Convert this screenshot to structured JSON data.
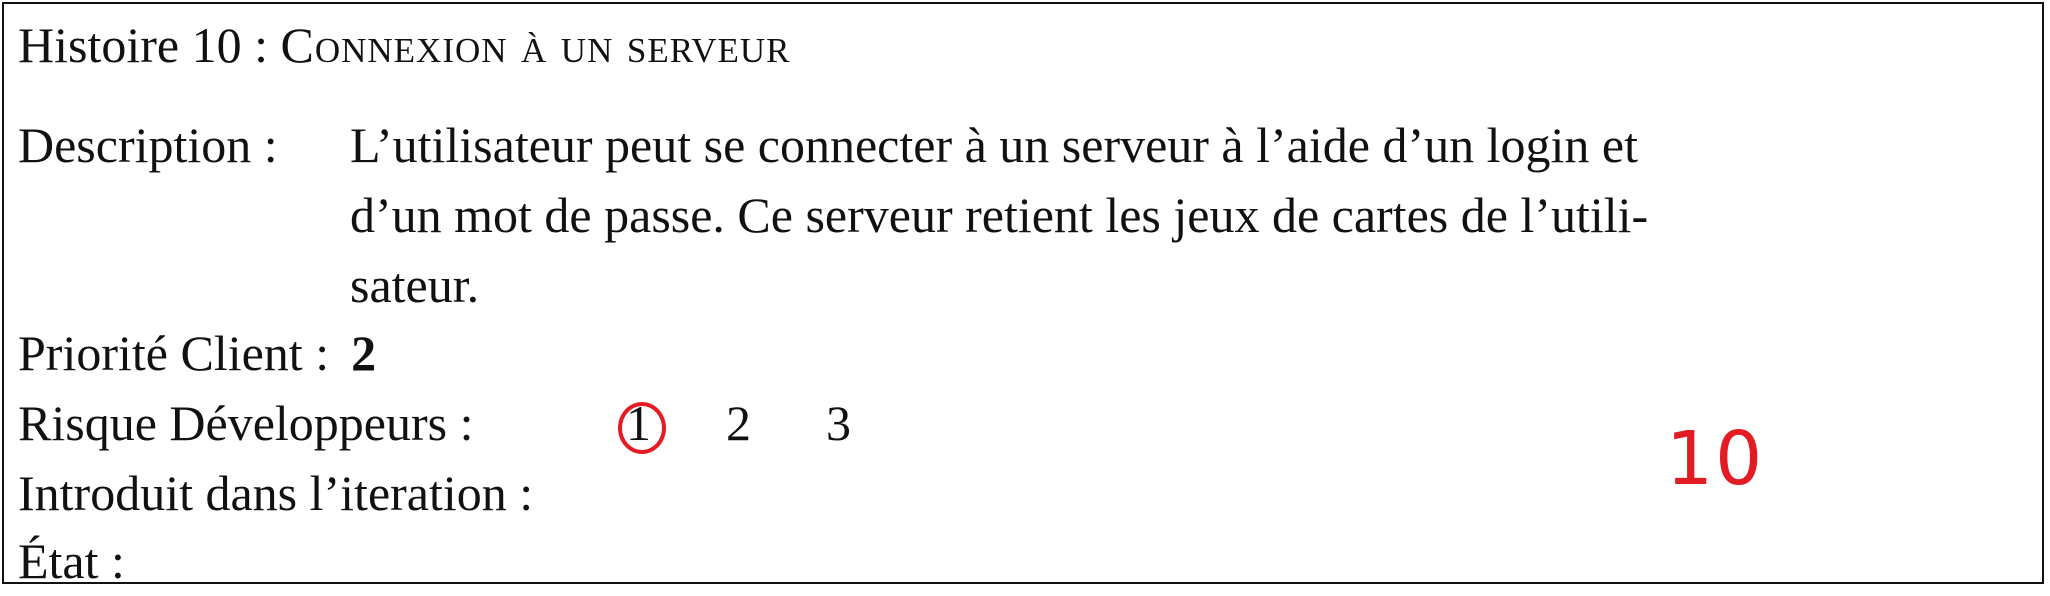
{
  "title": {
    "prefix": "Histoire 10 : ",
    "name": "Connexion à un serveur"
  },
  "description": {
    "label": "Description :",
    "lines": [
      "L’utilisateur peut se connecter à un serveur à l’aide d’un login et",
      "d’un mot de passe. Ce serveur retient les jeux de cartes de l’utili-",
      "sateur."
    ]
  },
  "priority": {
    "label": "Priorité Client :",
    "value": "2"
  },
  "risk": {
    "label": "Risque Développeurs :",
    "options": [
      "1",
      "2",
      "3"
    ],
    "selected": "1",
    "mark_color": "#e31b23"
  },
  "iteration": {
    "label": "Introduit dans l’iteration :",
    "handwritten_value": "10"
  },
  "state": {
    "label": "État :"
  }
}
